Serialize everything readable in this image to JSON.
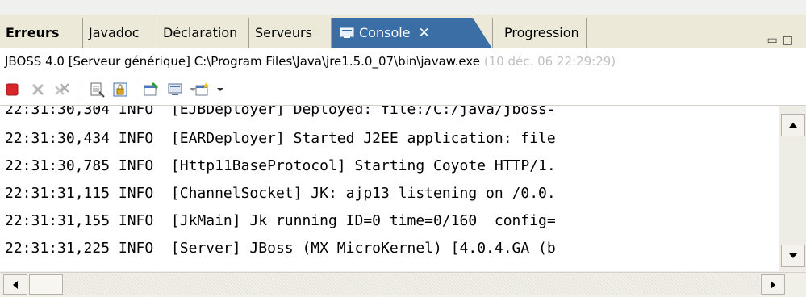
{
  "tabs": [
    {
      "label": "Erreurs"
    },
    {
      "label": "Javadoc"
    },
    {
      "label": "Déclaration"
    },
    {
      "label": "Serveurs"
    },
    {
      "label": "Console",
      "close": "✕"
    },
    {
      "label": "Progression"
    }
  ],
  "window_controls": {
    "minimize": "▭",
    "maximize": "□"
  },
  "title": {
    "text": "JBOSS 4.0 [Serveur générique] C:\\Program Files\\Java\\jre1.5.0_07\\bin\\javaw.exe",
    "faded": "(10 déc. 06 22:29:29)"
  },
  "toolbar_icons": [
    "terminate-icon",
    "remove-launch-icon",
    "remove-all-icon",
    "clear-console-icon",
    "scroll-lock-icon",
    "pin-console-icon",
    "display-console-icon",
    "open-console-icon"
  ],
  "console_lines": [
    "22:31:30,304 INFO  [EJBDeployer] Deployed: file:/C:/java/jboss-",
    "22:31:30,434 INFO  [EARDeployer] Started J2EE application: file",
    "22:31:30,785 INFO  [Http11BaseProtocol] Starting Coyote HTTP/1.",
    "22:31:31,115 INFO  [ChannelSocket] JK: ajp13 listening on /0.0.",
    "22:31:31,155 INFO  [JkMain] Jk running ID=0 time=0/160  config=",
    "22:31:31,225 INFO  [Server] JBoss (MX MicroKernel) [4.0.4.GA (b"
  ],
  "colors": {
    "active_tab": "#3a6ea5",
    "terminate": "#d8262b",
    "chrome": "#ece9d8"
  }
}
